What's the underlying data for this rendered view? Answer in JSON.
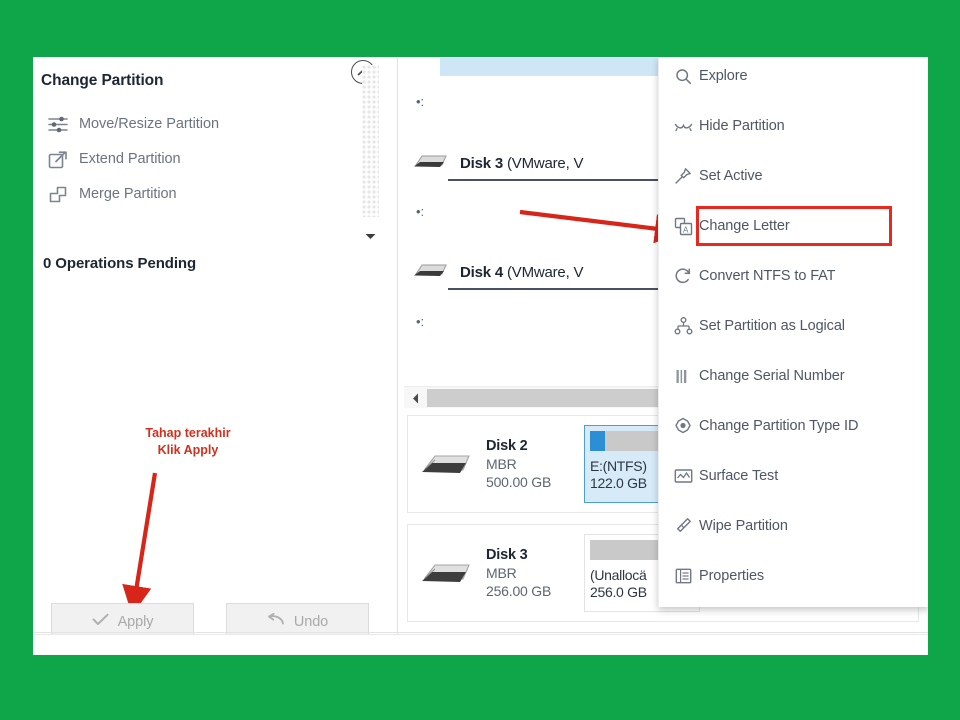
{
  "theme": {
    "page_background": "#0fa64a",
    "window_background": "#ffffff",
    "accent_blue": "#2b8fd6",
    "annotation_red": "#d32f1e",
    "highlight_box_red": "#e8291f"
  },
  "sidebar": {
    "section_title": "Change Partition",
    "collapse_icon": "chevron-up-circle-icon",
    "items": [
      {
        "label": "Move/Resize Partition",
        "icon": "sliders-icon"
      },
      {
        "label": "Extend Partition",
        "icon": "extend-arrow-icon"
      },
      {
        "label": "Merge Partition",
        "icon": "merge-squares-icon"
      }
    ],
    "scroll_down_icon": "chevron-down-icon",
    "operations_pending": "0 Operations Pending",
    "annotation": {
      "line1": "Tahap terakhir",
      "line2": "Klik Apply",
      "arrow": "red-arrow-down-icon"
    },
    "buttons": [
      {
        "label": "Apply",
        "icon": "checkmark-icon",
        "name": "apply-button"
      },
      {
        "label": "Undo",
        "icon": "undo-arrow-icon",
        "name": "undo-button"
      }
    ]
  },
  "disk_panel": {
    "clip_marker": "•:",
    "rows": [
      {
        "name": "Disk 3",
        "detail": " (VMware, V"
      },
      {
        "name": "Disk 4",
        "detail": " (VMware, V"
      }
    ],
    "hscroll_left_icon": "triangle-left-icon",
    "cards": [
      {
        "name": "Disk 2",
        "scheme": "MBR",
        "size": "500.00 GB",
        "icon": "hard-disk-icon",
        "partition": {
          "label": "E:(NTFS)",
          "size": "122.0 GB",
          "fill_percent": 14,
          "selected": true
        }
      },
      {
        "name": "Disk 3",
        "scheme": "MBR",
        "size": "256.00 GB",
        "icon": "hard-disk-icon",
        "partition": {
          "label": "(Unallocä",
          "size": "256.0 GB",
          "fill_percent": 0,
          "selected": false
        }
      }
    ],
    "arrow_to_menu": "red-arrow-right-icon"
  },
  "context_menu": {
    "items": [
      {
        "label": "Explore",
        "icon": "magnifier-icon",
        "highlighted": false
      },
      {
        "label": "Hide Partition",
        "icon": "hide-eye-icon",
        "highlighted": false
      },
      {
        "label": "Set Active",
        "icon": "pin-icon",
        "highlighted": false
      },
      {
        "label": "Change Letter",
        "icon": "change-letter-icon",
        "highlighted": true
      },
      {
        "label": "Convert NTFS to FAT",
        "icon": "convert-refresh-icon",
        "highlighted": false
      },
      {
        "label": "Set Partition as Logical",
        "icon": "hierarchy-icon",
        "highlighted": false
      },
      {
        "label": "Change Serial Number",
        "icon": "barcode-icon",
        "highlighted": false
      },
      {
        "label": "Change Partition Type ID",
        "icon": "gear-badge-icon",
        "highlighted": false
      },
      {
        "label": "Surface Test",
        "icon": "chart-frame-icon",
        "highlighted": false
      },
      {
        "label": "Wipe Partition",
        "icon": "eraser-icon",
        "highlighted": false
      },
      {
        "label": "Properties",
        "icon": "list-panel-icon",
        "highlighted": false
      }
    ]
  }
}
